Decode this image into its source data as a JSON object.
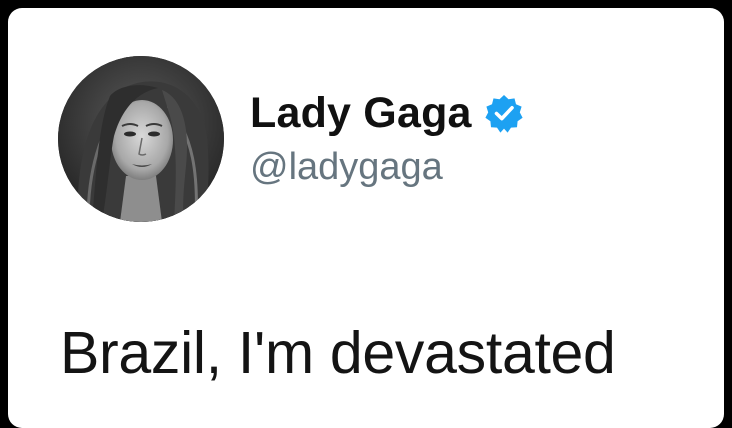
{
  "tweet": {
    "author": {
      "display_name": "Lady Gaga",
      "handle": "@ladygaga",
      "verified": true,
      "verified_icon": "verified-badge-icon",
      "avatar": "profile-photo"
    },
    "text": "Brazil, I'm devastated"
  },
  "colors": {
    "background": "#000000",
    "card": "#ffffff",
    "name": "#111111",
    "handle": "#66757f",
    "verified": "#1da1f2",
    "text": "#141414"
  }
}
